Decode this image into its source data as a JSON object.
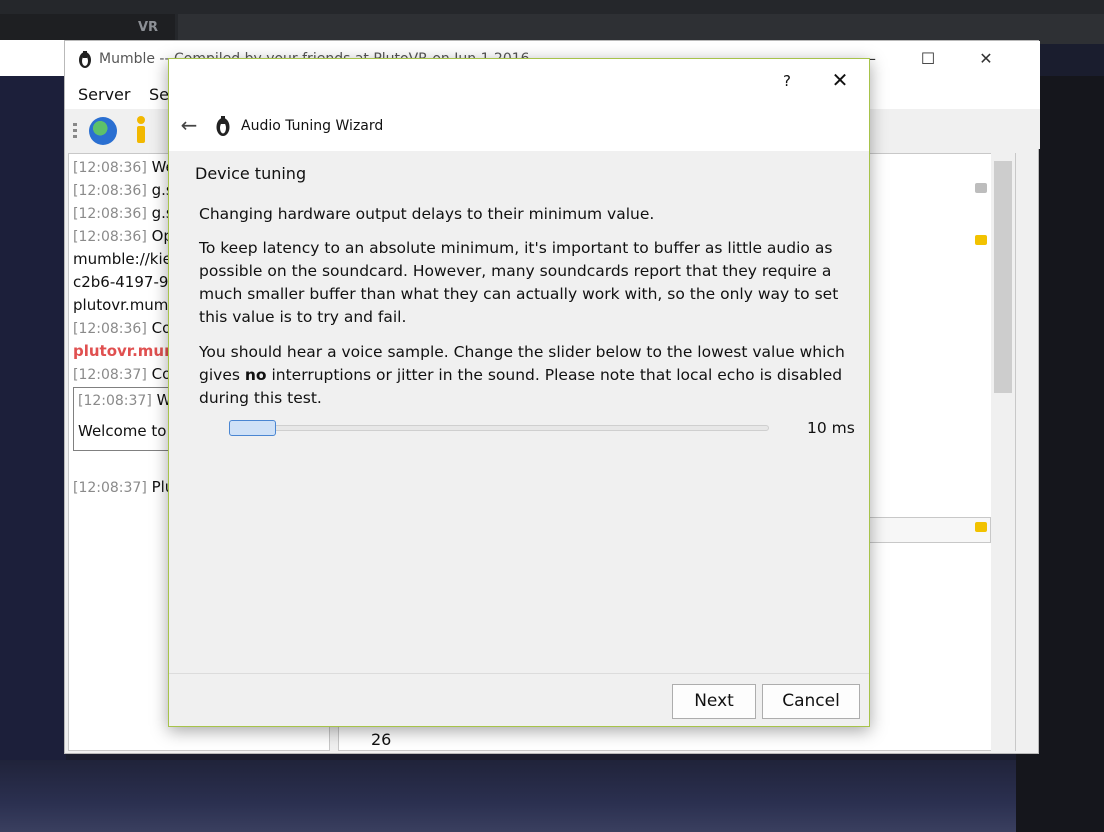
{
  "background": {
    "tab_label": "VR"
  },
  "mumble": {
    "window_title": "Mumble -- Compiled by your friends at PlutoVR on Jun  1 2016",
    "menu": [
      "Server",
      "Sel"
    ],
    "chat_log": [
      {
        "ts": "[12:08:36]",
        "text": "Wel"
      },
      {
        "ts": "[12:08:36]",
        "text": "g.s.f"
      },
      {
        "ts": "[12:08:36]",
        "text": "g.s.f"
      },
      {
        "ts": "[12:08:36]",
        "text": "Ope"
      },
      {
        "ts": "",
        "text": "mumble://kie"
      },
      {
        "ts": "",
        "text": "c2b6-4197-9"
      },
      {
        "ts": "",
        "text": "plutovr.mum"
      },
      {
        "ts": "[12:08:36]",
        "text": "Con"
      },
      {
        "ts": "",
        "text": "plutovr.mum"
      },
      {
        "ts": "[12:08:37]",
        "text": "Con"
      }
    ],
    "log_box": {
      "ts": "[12:08:37]",
      "text": "We",
      "body": "Welcome to"
    },
    "last_line": {
      "ts": "[12:08:37]",
      "text": "Plut"
    },
    "tree_number": "26"
  },
  "wizard": {
    "help_label": "?",
    "close_label": "✕",
    "back_label": "←",
    "title": "Audio Tuning Wizard",
    "page_title": "Device tuning",
    "subtitle": "Changing hardware output delays to their minimum value.",
    "para1": "To keep latency to an absolute minimum, it's important to buffer as little audio as possible on the soundcard. However, many soundcards report that they require a much smaller buffer than what they can actually work with, so the only way to set this value is to try and fail.",
    "para2_before": "You should hear a voice sample. Change the slider below to the lowest value which gives ",
    "para2_bold": "no",
    "para2_after": " interruptions or jitter in the sound. Please note that local echo is disabled during this test.",
    "slider_value": "10 ms",
    "slider_fraction": 0,
    "next_label": "Next",
    "cancel_label": "Cancel"
  }
}
